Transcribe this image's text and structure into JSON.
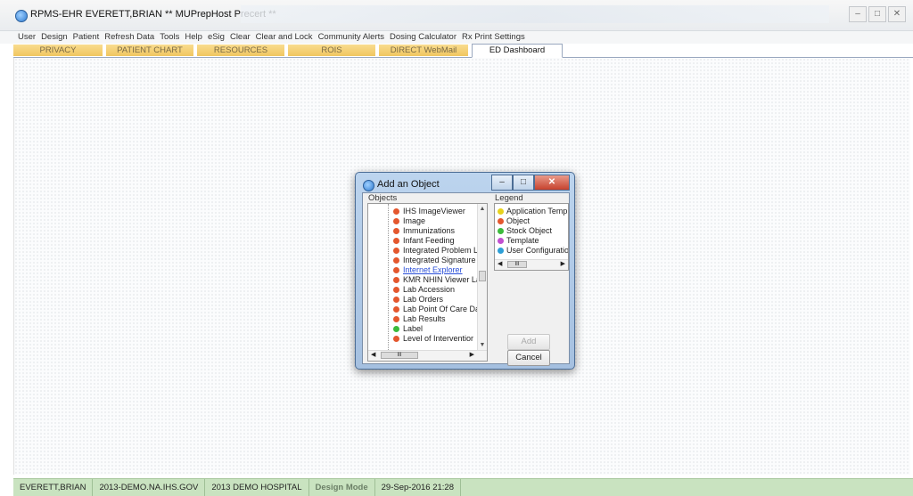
{
  "window": {
    "title": "RPMS-EHR EVERETT,BRIAN    ** MUPrepHost Precert **"
  },
  "menu": [
    "User",
    "Design",
    "Patient",
    "Refresh Data",
    "Tools",
    "Help",
    "eSig",
    "Clear",
    "Clear and Lock",
    "Community Alerts",
    "Dosing Calculator",
    "Rx Print Settings"
  ],
  "tabs": [
    "PRIVACY",
    "PATIENT CHART",
    "RESOURCES",
    "ROIS",
    "DIRECT WebMail",
    "ED Dashboard"
  ],
  "active_tab": "ED Dashboard",
  "dialog": {
    "title": "Add an Object",
    "objects_label": "Objects",
    "legend_label": "Legend",
    "objects": [
      {
        "label": "IHS ImageViewer",
        "type": "Object"
      },
      {
        "label": "Image",
        "type": "Object"
      },
      {
        "label": "Immunizations",
        "type": "Object"
      },
      {
        "label": "Infant Feeding",
        "type": "Object"
      },
      {
        "label": "Integrated Problem List",
        "type": "Object"
      },
      {
        "label": "Integrated Signature Tc",
        "type": "Object"
      },
      {
        "label": "Internet Explorer",
        "type": "Object",
        "selected": true
      },
      {
        "label": "KMR NHIN Viewer Laun",
        "type": "Object"
      },
      {
        "label": "Lab Accession",
        "type": "Object"
      },
      {
        "label": "Lab Orders",
        "type": "Object"
      },
      {
        "label": "Lab Point Of Care Data",
        "type": "Object"
      },
      {
        "label": "Lab Results",
        "type": "Object"
      },
      {
        "label": "Label",
        "type": "Stock Object"
      },
      {
        "label": "Level of Interventior",
        "type": "Object"
      }
    ],
    "legend": [
      {
        "label": "Application Temp",
        "color": "#e7d21d"
      },
      {
        "label": "Object",
        "color": "#e4572e"
      },
      {
        "label": "Stock Object",
        "color": "#3cba3c"
      },
      {
        "label": "Template",
        "color": "#c24fd0"
      },
      {
        "label": "User Configuratior",
        "color": "#2d9fd6"
      }
    ],
    "add_label": "Add",
    "cancel_label": "Cancel",
    "scroll_thumb": "III"
  },
  "status": {
    "user": "EVERETT,BRIAN",
    "domain": "2013-DEMO.NA.IHS.GOV",
    "facility": "2013 DEMO HOSPITAL",
    "mode": "Design Mode",
    "datetime": "29-Sep-2016 21:28"
  },
  "colors": {
    "object": "#e4572e",
    "stock_object": "#3cba3c",
    "status_bg": "#c9e3c0",
    "tab_bg": "#f0c660"
  }
}
